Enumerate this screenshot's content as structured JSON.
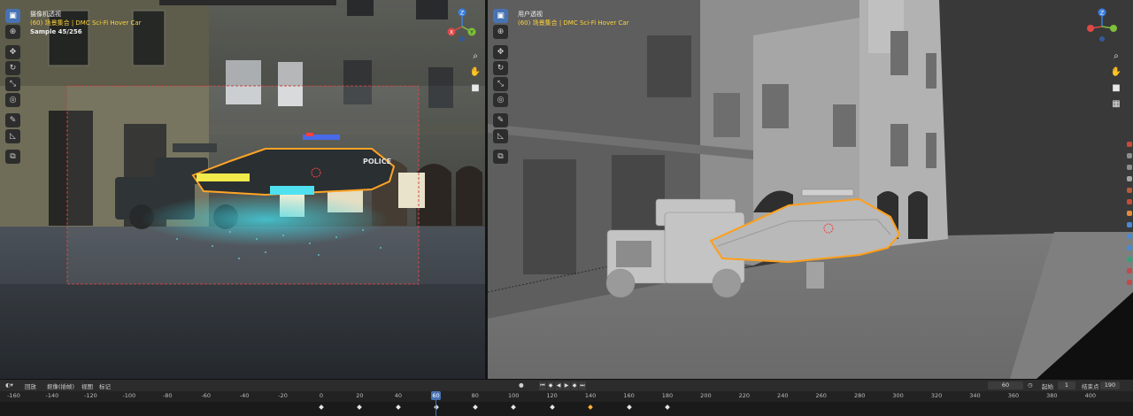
{
  "left_viewport": {
    "title": "摄像机透视",
    "collection": "(60) 场景集合 | DMC Sci-Fi Hover Car",
    "sample": "Sample 45/256",
    "police_text": "POLICE"
  },
  "right_viewport": {
    "title": "用户透视",
    "collection": "(60) 场景集合 | DMC Sci-Fi Hover Car"
  },
  "gizmo": {
    "x": "X",
    "y": "Y",
    "z": "Z"
  },
  "toolbar_icons": [
    "select-box-icon",
    "cursor-icon",
    "move-icon",
    "rotate-icon",
    "scale-icon",
    "transform-icon",
    "annotate-icon",
    "measure-icon",
    "add-cube-icon"
  ],
  "timeline": {
    "menu_playback": "回放",
    "menu_keying": "抠像(插帧)",
    "menu_view": "视图",
    "menu_marker": "标记",
    "current_frame": "60",
    "start_label": "起始",
    "start_value": "1",
    "end_label": "结束点",
    "end_value": "190",
    "ruler": [
      "-160",
      "-140",
      "-120",
      "-100",
      "-80",
      "-60",
      "-40",
      "-20",
      "0",
      "20",
      "40",
      "60",
      "80",
      "100",
      "120",
      "140",
      "160",
      "180",
      "200",
      "220",
      "240",
      "260",
      "280",
      "300",
      "320",
      "340",
      "360",
      "380",
      "400"
    ],
    "keyframes": [
      0,
      20,
      40,
      60,
      80,
      100,
      120,
      140,
      160,
      180
    ],
    "selected_keyframe": 140
  },
  "colors": {
    "accent": "#4772b3",
    "selection_outline": "#ff9f1a",
    "overlay_yellow": "#ffd43b"
  }
}
